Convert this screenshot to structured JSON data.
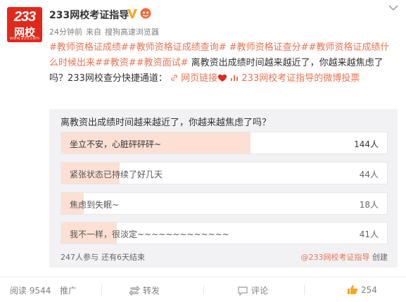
{
  "author": {
    "avatar_text": "233",
    "avatar_text2": "网校",
    "avatar_small": "www.233.com",
    "name": "233网校考证指导",
    "verified_icon": "verified-v-icon",
    "badge_icon": "member-badge-icon"
  },
  "meta": {
    "time": "24分钟前",
    "source_prefix": "来自",
    "source": "搜狗高速浏览器"
  },
  "content": {
    "tags": [
      "#教师资格证成绩#",
      "#教师资格证成绩查询#",
      "#教师资格证查分#",
      "#教师资格证成绩什么时候出来#",
      "#教资#",
      "#教资面试#"
    ],
    "text": "离教资出成绩时间越来越近了，你越来越焦虑了吗？233网校查分快捷通道：",
    "link1": "网页链接",
    "link2": "233网校考证指导的微博投票"
  },
  "poll": {
    "question": "离教资出成绩时间越来越近了，你越来越焦虑了吗？",
    "options": [
      {
        "label": "坐立不安，心脏砰砰砰~",
        "count": "144人",
        "ratio": 0.58
      },
      {
        "label": "紧张状态已持续了好几天",
        "count": "44人",
        "ratio": 0.18
      },
      {
        "label": "焦虑到失眠~",
        "count": "18人",
        "ratio": 0.07
      },
      {
        "label": "我不一样，很淡定~~~~~~~~~~~~~",
        "count": "41人",
        "ratio": 0.17
      }
    ],
    "participants": "247人参与",
    "remaining": "还有6天结束",
    "creator": "@233网校考证指导",
    "created_label": "创建"
  },
  "actions": {
    "read": "阅读 9544",
    "promote": "推广",
    "repost": "转发",
    "comment": "评论",
    "like": "254"
  },
  "colors": {
    "accent": "#eb7350",
    "brand_red": "#e2281b",
    "poll_bg": "#f2f2f5",
    "poll_fill": "#fde0d3"
  }
}
